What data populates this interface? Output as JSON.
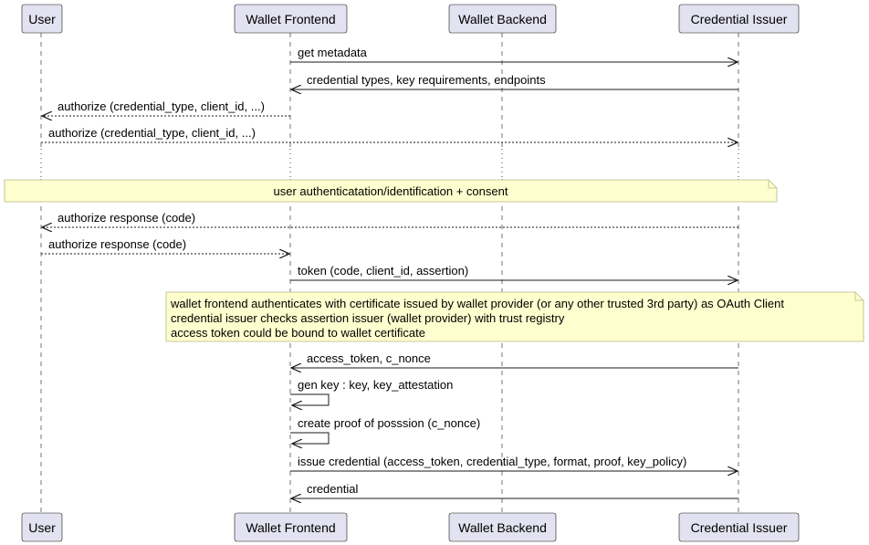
{
  "participants": [
    {
      "id": "user",
      "label": "User"
    },
    {
      "id": "frontend",
      "label": "Wallet Frontend"
    },
    {
      "id": "backend",
      "label": "Wallet Backend"
    },
    {
      "id": "issuer",
      "label": "Credential Issuer"
    }
  ],
  "colors": {
    "participant_fill": "#e2e2f0",
    "participant_border": "#181818",
    "note_fill": "#fefece",
    "note_border": "#b8b88a",
    "lifeline": "#181818",
    "arrow": "#181818"
  },
  "messages": [
    {
      "from": "frontend",
      "to": "issuer",
      "label": "get metadata",
      "style": "solid"
    },
    {
      "from": "issuer",
      "to": "frontend",
      "label": "credential types, key requirements, endpoints",
      "style": "solid"
    },
    {
      "from": "frontend",
      "to": "user",
      "label": "authorize (credential_type, client_id, ...)",
      "style": "dashed"
    },
    {
      "from": "user",
      "to": "issuer",
      "label": "authorize (credential_type, client_id, ...)",
      "style": "dashed"
    },
    {
      "from": "issuer",
      "to": "user",
      "label": "authorize response (code)",
      "style": "dashed"
    },
    {
      "from": "user",
      "to": "frontend",
      "label": "authorize response (code)",
      "style": "dashed"
    },
    {
      "from": "frontend",
      "to": "issuer",
      "label": "token (code, client_id, assertion)",
      "style": "solid"
    },
    {
      "from": "issuer",
      "to": "frontend",
      "label": "access_token, c_nonce",
      "style": "solid"
    },
    {
      "from": "frontend",
      "to": "frontend",
      "label": "gen key : key, key_attestation",
      "style": "self"
    },
    {
      "from": "frontend",
      "to": "frontend",
      "label": "create proof of posssion (c_nonce)",
      "style": "self"
    },
    {
      "from": "frontend",
      "to": "issuer",
      "label": "issue credential (access_token, credential_type, format, proof, key_policy)",
      "style": "solid"
    },
    {
      "from": "issuer",
      "to": "frontend",
      "label": "credential",
      "style": "solid"
    }
  ],
  "notes": [
    {
      "lines": [
        "user authenticatation/identification + consent"
      ],
      "align": "center"
    },
    {
      "lines": [
        "wallet frontend authenticates with certificate issued by wallet provider (or any other trusted 3rd party) as OAuth Client",
        "credential issuer checks assertion issuer (wallet provider) with trust registry",
        "access token could be bound to wallet certificate"
      ],
      "align": "left"
    }
  ]
}
